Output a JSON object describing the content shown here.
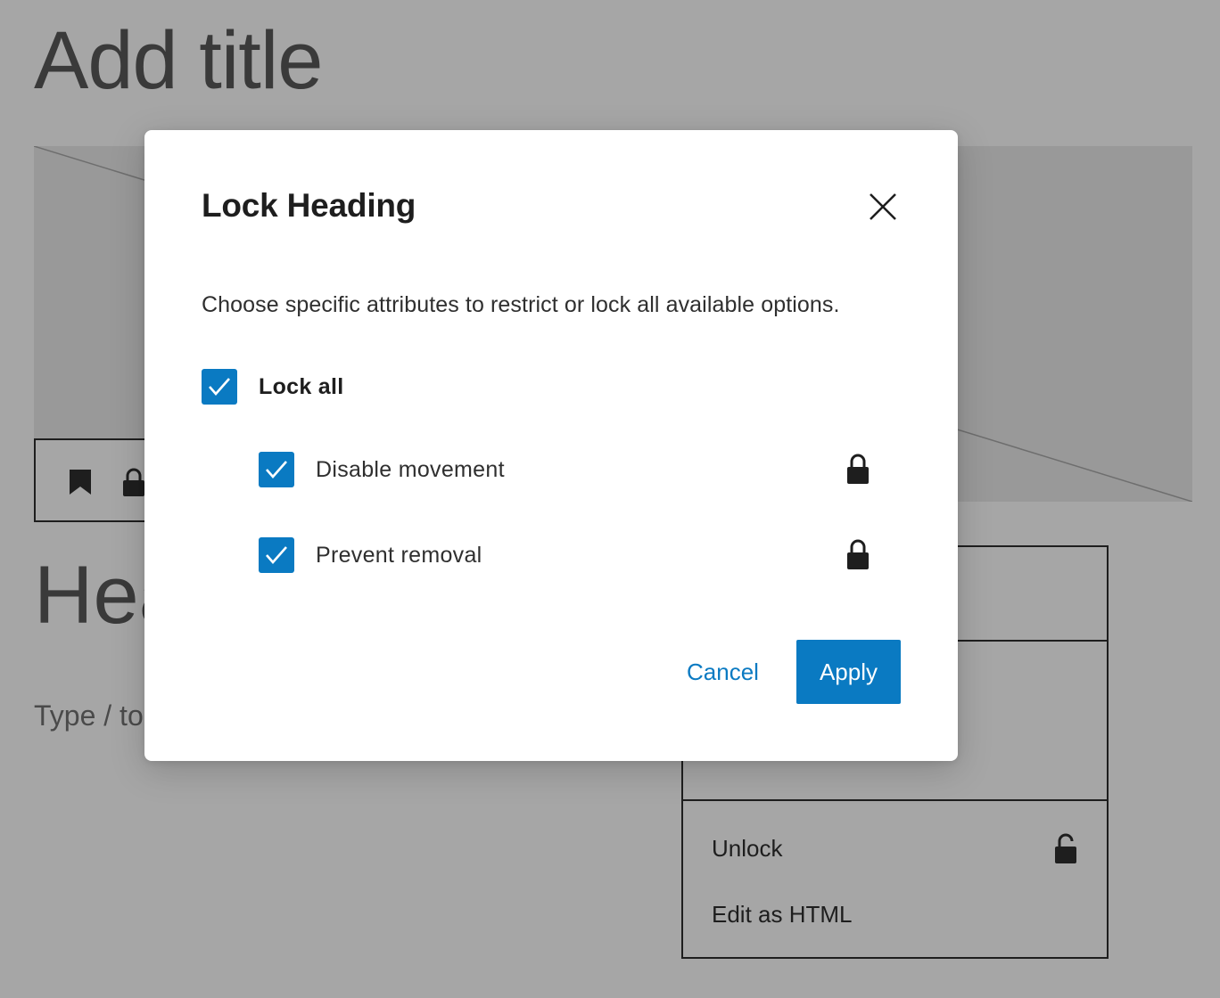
{
  "editor": {
    "post_title_placeholder": "Add title",
    "heading_partial": "Hea",
    "paragraph_placeholder_partial": "Type / to"
  },
  "options_menu": {
    "items": [
      {
        "label": "Unlock",
        "icon": "unlock-icon"
      },
      {
        "label": "Edit as HTML"
      }
    ]
  },
  "modal": {
    "title": "Lock Heading",
    "description": "Choose specific attributes to restrict or lock all available options.",
    "lock_all": {
      "label": "Lock all",
      "checked": true
    },
    "options": [
      {
        "label": "Disable movement",
        "checked": true,
        "icon": "lock-icon"
      },
      {
        "label": "Prevent removal",
        "checked": true,
        "icon": "lock-icon"
      }
    ],
    "cancel_label": "Cancel",
    "apply_label": "Apply"
  },
  "colors": {
    "accent": "#0a7ac2",
    "overlay_background": "#a6a6a6",
    "modal_background": "#ffffff"
  }
}
